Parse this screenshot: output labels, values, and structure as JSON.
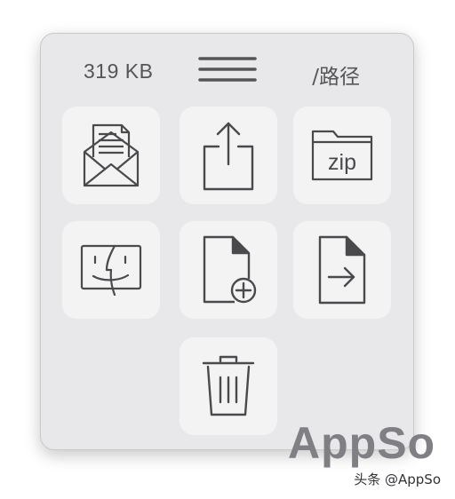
{
  "header": {
    "size": "319 KB",
    "menu_icon": "hamburger-menu-icon",
    "path": "/路径"
  },
  "actions": [
    {
      "name": "mail-attachment",
      "icon": "open-envelope-icon"
    },
    {
      "name": "share",
      "icon": "share-upload-icon"
    },
    {
      "name": "compress-zip",
      "icon": "zip-folder-icon",
      "icon_text": "zip"
    },
    {
      "name": "reveal-in-finder",
      "icon": "finder-face-icon"
    },
    {
      "name": "new-file",
      "icon": "document-add-icon"
    },
    {
      "name": "move-file",
      "icon": "document-arrow-icon"
    },
    {
      "name": "delete",
      "icon": "trash-icon"
    }
  ],
  "watermark": {
    "logo": "AppSo",
    "credit": "头条 @AppSo"
  },
  "colors": {
    "panel": "#e8e8ea",
    "tile": "#f3f3f4",
    "icon_stroke": "#4a4a4d",
    "watermark": "#7f7f84"
  }
}
